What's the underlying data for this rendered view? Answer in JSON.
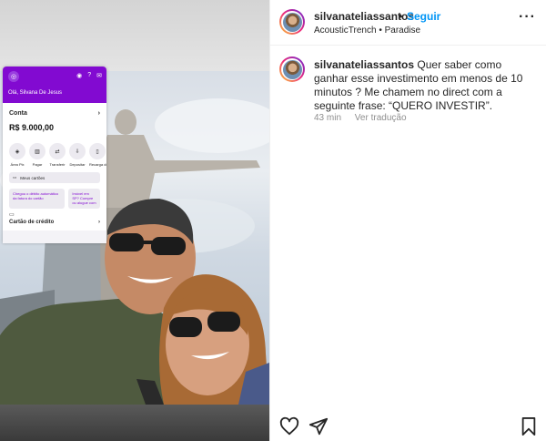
{
  "post": {
    "username": "silvanateliassantos",
    "separator": "•",
    "follow_label": "Seguir",
    "location_line": "AcousticTrench • Paradise",
    "more_icon": "more-horizontal-icon"
  },
  "caption": {
    "username": "silvanateliassantos",
    "text": "Quer saber como ganhar esse investimento em menos de 10 minutos ? Me chamem no direct com a seguinte frase: “QUERO INVESTIR”.",
    "time": "43 min",
    "translate_label": "Ver tradução"
  },
  "phone_app": {
    "greeting": "Olá, Silvana De Jesus",
    "account_label": "Conta",
    "balance": "R$ 9.000,00",
    "actions": [
      "Área Pix",
      "Pagar",
      "Transferir",
      "Depositar",
      "Recarga de celular"
    ],
    "cards_label": "Meus cartões",
    "promo_1": "Chegou o débito automático da fatura do cartão",
    "promo_2": "Imóvel em SP? Compre ou alugue com",
    "credit_label": "Cartão de crédito",
    "accent_color": "#820ad1"
  },
  "icons": {
    "like": "heart-icon",
    "share": "paper-plane-icon",
    "save": "bookmark-icon"
  },
  "colors": {
    "link_blue": "#0095f6",
    "muted": "#8e8e8e",
    "text": "#262626"
  }
}
